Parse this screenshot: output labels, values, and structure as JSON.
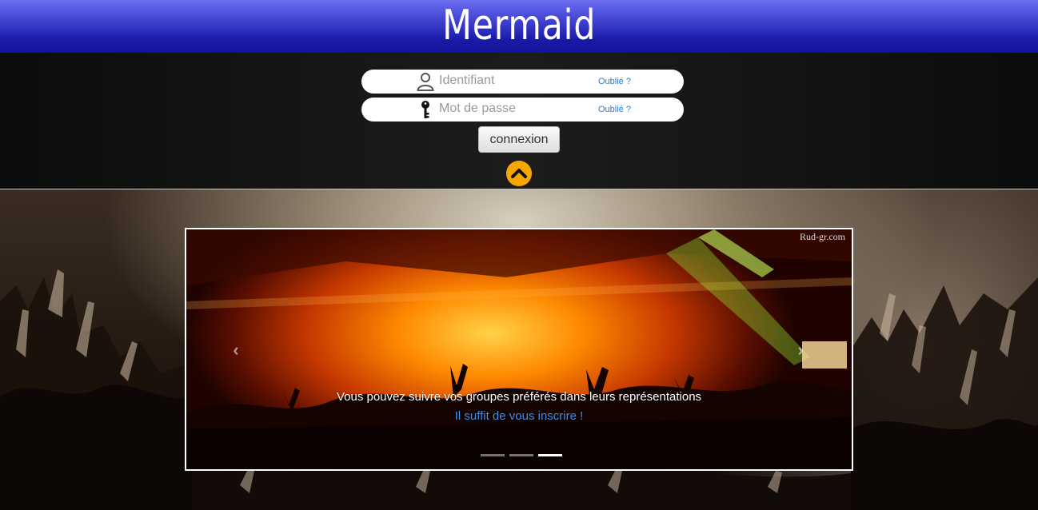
{
  "header": {
    "brand": "Mermaid"
  },
  "login": {
    "username_placeholder": "Identifiant",
    "password_placeholder": "Mot de passe",
    "forgot_username": "Oublié ?",
    "forgot_password": "Oublié ?",
    "submit_label": "connexion",
    "toggle_icon": "chevron-up-icon",
    "user_icon": "user-icon",
    "key_icon": "key-icon",
    "accent_color": "#f7a500"
  },
  "carousel": {
    "watermark": "Rud-gr.com",
    "prev_label": "‹",
    "next_label": "›",
    "caption": "Vous pouvez suivre vos groupes préférés dans leurs représentations",
    "cta": "Il suffit de vous inscrire !",
    "slide_count": 3,
    "active_slide": 3
  }
}
